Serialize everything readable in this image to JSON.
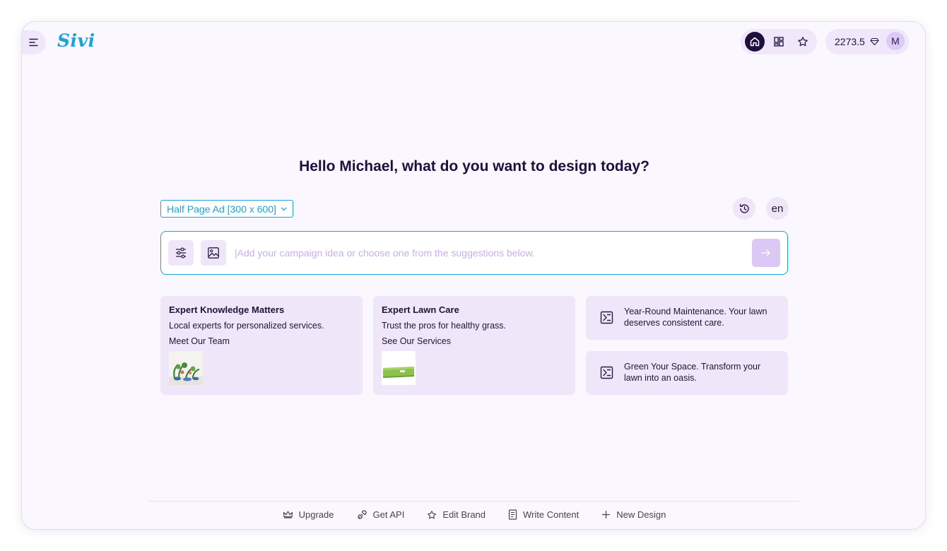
{
  "header": {
    "logo_text": "Sivi",
    "credits": "2273.5",
    "avatar_initial": "M"
  },
  "main": {
    "headline": "Hello Michael, what do you want to design today?",
    "size_select": "Half Page Ad [300 x 600]",
    "language": "en",
    "prompt_placeholder": "|Add your campaign idea or choose one from the suggestions below."
  },
  "suggestions": [
    {
      "title": "Expert Knowledge Matters",
      "subtitle": "Local experts for personalized services.",
      "cta": "Meet Our Team",
      "thumb": "potted-plants-image"
    },
    {
      "title": "Expert Lawn Care",
      "subtitle": "Trust the pros for healthy grass.",
      "cta": "See Our Services",
      "thumb": "lawn-grass-image"
    }
  ],
  "text_suggestions": [
    "Year-Round Maintenance. Your lawn deserves consistent care.",
    "Green Your Space. Transform your lawn into an oasis."
  ],
  "footer": [
    {
      "label": "Upgrade",
      "icon": "crown-icon"
    },
    {
      "label": "Get API",
      "icon": "plug-icon"
    },
    {
      "label": "Edit Brand",
      "icon": "star-icon"
    },
    {
      "label": "Write Content",
      "icon": "document-icon"
    },
    {
      "label": "New Design",
      "icon": "plus-icon"
    }
  ],
  "colors": {
    "accent": "#1aa3d6",
    "background": "#faf7fe",
    "card": "#efe6fa",
    "active_nav": "#1f0f3d"
  }
}
